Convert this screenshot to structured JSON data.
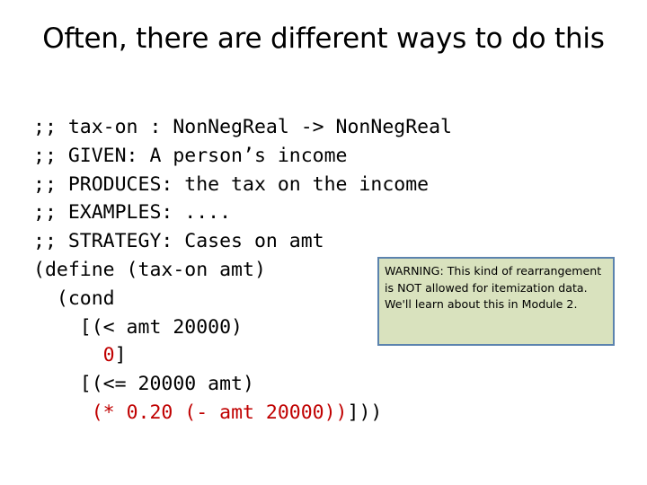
{
  "slide": {
    "title": "Often, there are different ways to do this",
    "code_lines": [
      {
        "text": ";; tax-on : NonNegReal -> NonNegReal",
        "segments": [
          {
            "text": ";; tax-on : NonNegReal -> NonNegReal",
            "color": "black"
          }
        ]
      },
      {
        "text": ";; GIVEN: A person’s income",
        "segments": [
          {
            "text": ";; GIVEN: A person’s income",
            "color": "black"
          }
        ]
      },
      {
        "text": ";; PRODUCES: the tax on the income",
        "segments": [
          {
            "text": ";; PRODUCES: the tax on the income",
            "color": "black"
          }
        ]
      },
      {
        "text": ";; EXAMPLES: ....",
        "segments": [
          {
            "text": ";; EXAMPLES: ....",
            "color": "black"
          }
        ]
      },
      {
        "text": ";; STRATEGY: Cases on amt",
        "segments": [
          {
            "text": ";; STRATEGY: Cases on amt",
            "color": "black"
          }
        ]
      },
      {
        "text": "(define (tax-on amt)",
        "segments": [
          {
            "text": "(define (tax-on amt)",
            "color": "black"
          }
        ]
      },
      {
        "text": "  (cond",
        "segments": [
          {
            "text": "  (cond",
            "color": "black"
          }
        ]
      },
      {
        "text": "    [(< amt 20000)",
        "segments": [
          {
            "text": "    [(< amt 20000)",
            "color": "black"
          }
        ]
      },
      {
        "text": "      0]",
        "segments": [
          {
            "text": "      ",
            "color": "black"
          },
          {
            "text": "0",
            "color": "red"
          },
          {
            "text": "]",
            "color": "black"
          }
        ]
      },
      {
        "text": "    [(<= 20000 amt)",
        "segments": [
          {
            "text": "    [(<= 20000 amt)",
            "color": "black"
          }
        ]
      },
      {
        "text": "     (* 0.20 (- amt 20000))]))",
        "segments": [
          {
            "text": "     ",
            "color": "black"
          },
          {
            "text": "(* 0.20 (- amt 20000))",
            "color": "red"
          },
          {
            "text": "]))",
            "color": "black"
          }
        ]
      }
    ],
    "warning": {
      "text": "WARNING: This kind of rearrangement is NOT allowed for itemization data.  We'll learn about this in Module 2.",
      "fill_color": "#D9E2BE",
      "border_color": "#5B83AE"
    },
    "colors": {
      "code_black": "#000000",
      "code_red": "#C00000",
      "background": "#FFFFFF"
    }
  }
}
